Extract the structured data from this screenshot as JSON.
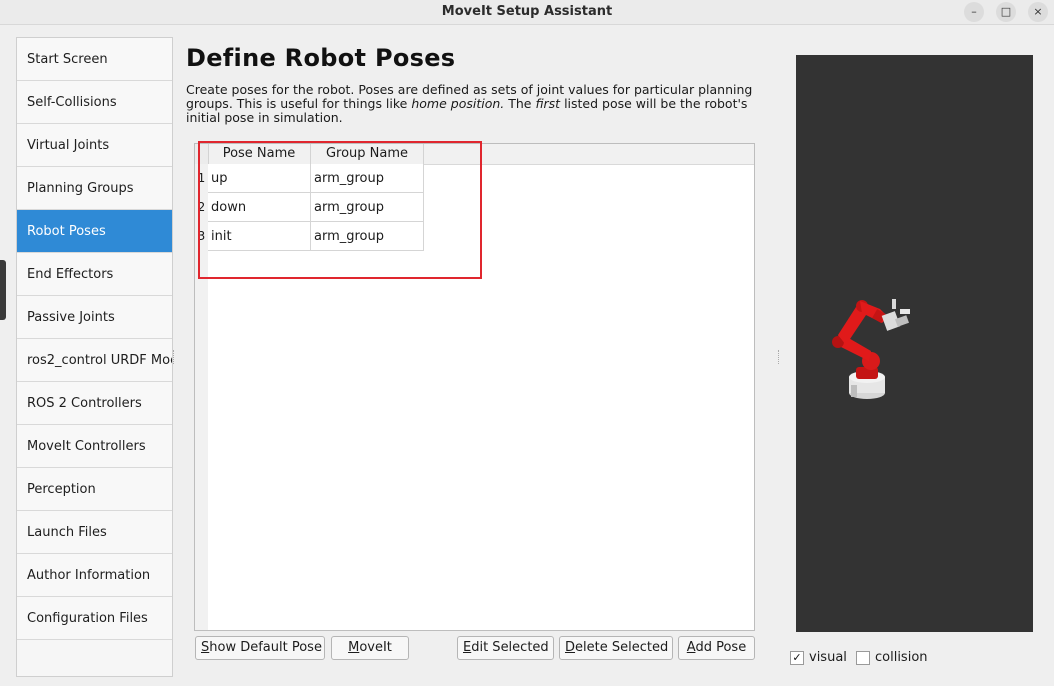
{
  "window": {
    "title": "MoveIt Setup Assistant",
    "controls": {
      "minimize": "–",
      "maximize": "□",
      "close": "×"
    }
  },
  "sidebar": {
    "items": [
      {
        "label": "Start Screen"
      },
      {
        "label": "Self-Collisions"
      },
      {
        "label": "Virtual Joints"
      },
      {
        "label": "Planning Groups"
      },
      {
        "label": "Robot Poses",
        "active": true
      },
      {
        "label": "End Effectors"
      },
      {
        "label": "Passive Joints"
      },
      {
        "label": "ros2_control URDF Moc"
      },
      {
        "label": "ROS 2 Controllers"
      },
      {
        "label": "MoveIt Controllers"
      },
      {
        "label": "Perception"
      },
      {
        "label": "Launch Files"
      },
      {
        "label": "Author Information"
      },
      {
        "label": "Configuration Files"
      }
    ],
    "active_color": "#2f8ad6"
  },
  "main": {
    "title": "Define Robot Poses",
    "description": {
      "part1": "Create poses for the robot. Poses are defined as sets of joint values for particular planning groups. This is useful for things like ",
      "em1": "home position.",
      "part2": " The ",
      "em2": "first",
      "part3": " listed pose will be the robot's initial pose in simulation."
    },
    "table": {
      "columns": [
        "Pose Name",
        "Group Name"
      ],
      "rows": [
        {
          "num": "1",
          "pose": "up",
          "group": "arm_group"
        },
        {
          "num": "2",
          "pose": "down",
          "group": "arm_group"
        },
        {
          "num": "3",
          "pose": "init",
          "group": "arm_group"
        }
      ]
    },
    "buttons": {
      "show_default_pose": {
        "mnemonic": "S",
        "rest": "how Default Pose"
      },
      "moveit": {
        "mnemonic": "M",
        "rest": "oveIt"
      },
      "edit_selected": {
        "mnemonic": "E",
        "rest": "dit Selected"
      },
      "delete_selected": {
        "mnemonic": "D",
        "rest": "elete Selected"
      },
      "add_pose": {
        "mnemonic": "A",
        "rest": "dd Pose"
      }
    },
    "highlight_color": "#e0262e"
  },
  "viewer": {
    "background": "#333333",
    "robot_color": "#e01a1a",
    "visual": {
      "label": "visual",
      "checked": true,
      "mark": "✓"
    },
    "collision": {
      "label": "collision",
      "checked": false
    }
  }
}
